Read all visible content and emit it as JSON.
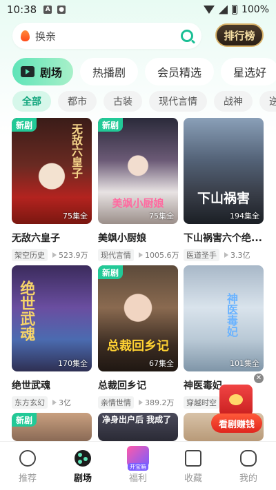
{
  "status_bar": {
    "time": "10:38",
    "battery": "100%",
    "icons": [
      "a-notification-icon",
      "shield-icon",
      "wifi-icon",
      "cell-signal-icon",
      "battery-icon"
    ]
  },
  "search": {
    "placeholder": "换亲",
    "icon": "search-icon"
  },
  "rank_button": "排行榜",
  "tabs": [
    "剧场",
    "热播剧",
    "会员精选",
    "星选好"
  ],
  "chips": [
    "全部",
    "都市",
    "古装",
    "现代言情",
    "战神",
    "逆袭"
  ],
  "cards": [
    {
      "badge": "新剧",
      "poster_text": "无敌六皇子",
      "episodes": "75集全",
      "title": "无敌六皇子",
      "tag": "架空历史",
      "plays": "523.9万"
    },
    {
      "badge": "新剧",
      "poster_text": "美飒小厨娘",
      "episodes": "75集全",
      "title": "美飒小厨娘",
      "tag": "现代言情",
      "plays": "1005.6万"
    },
    {
      "badge": "",
      "poster_text": "下山祸害",
      "episodes": "194集全",
      "title": "下山祸害六个绝...",
      "tag": "医道圣手",
      "plays": "3.3亿"
    },
    {
      "badge": "",
      "poster_text": "绝世武魂",
      "episodes": "170集全",
      "title": "绝世武魂",
      "tag": "东方玄幻",
      "plays": "3亿"
    },
    {
      "badge": "新剧",
      "poster_text": "总裁回乡记",
      "episodes": "67集全",
      "title": "总裁回乡记",
      "tag": "亲情世情",
      "plays": "389.2万"
    },
    {
      "badge": "",
      "poster_text": "神医毒妃",
      "episodes": "101集全",
      "title": "神医毒妃",
      "tag": "穿越时空",
      "plays": ""
    },
    {
      "badge": "新剧",
      "poster_text": "",
      "episodes": "",
      "title": "",
      "tag": "",
      "plays": ""
    },
    {
      "badge": "",
      "poster_text": "净身出户后 我成了",
      "episodes": "",
      "title": "",
      "tag": "",
      "plays": ""
    },
    {
      "badge": "",
      "poster_text": "",
      "episodes": "",
      "title": "",
      "tag": "",
      "plays": ""
    }
  ],
  "float_promo": {
    "label": "看剧赚钱",
    "close": "✕"
  },
  "bottom_nav": [
    {
      "label": "推荐",
      "icon": "planet-icon"
    },
    {
      "label": "剧场",
      "icon": "theater-icon"
    },
    {
      "label": "福利",
      "icon": "gift-icon",
      "tag": "开宝箱"
    },
    {
      "label": "收藏",
      "icon": "bookmark-icon"
    },
    {
      "label": "我的",
      "icon": "profile-icon"
    }
  ],
  "colors": {
    "accent": "#22c997",
    "search_icon": "#1bbf95",
    "rank_gold": "#d9b36a"
  }
}
